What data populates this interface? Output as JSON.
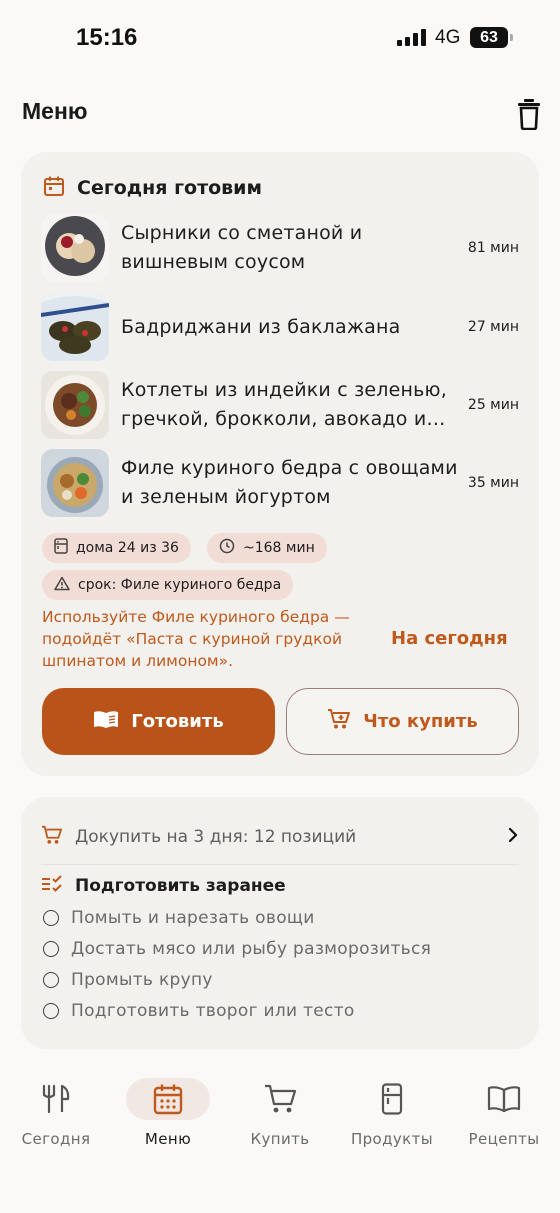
{
  "status": {
    "time": "15:16",
    "network": "4G",
    "battery": "63"
  },
  "header": {
    "title": "Меню",
    "trash_icon": "trash-icon"
  },
  "today": {
    "title": "Сегодня готовим",
    "dishes": [
      {
        "name": "Сырники со сметаной и вишневым соусом",
        "time": "81 мин"
      },
      {
        "name": "Бадриджани из баклажана",
        "time": "27 мин"
      },
      {
        "name": "Котлеты из индейки с зеленью, гречкой, брокколи, авокадо и…",
        "time": "25 мин"
      },
      {
        "name": "Филе куриного бедра с овощами и зеленым йогуртом",
        "time": "35 мин"
      }
    ],
    "chips": {
      "home": "дома 24 из 36",
      "duration": "~168 мин",
      "expiry": "срок: Филе куриного бедра"
    },
    "suggestion": "Используйте Филе куриного бедра — подойдёт «Паста с куриной грудкой шпинатом и лимоном».",
    "suggestion_action": "На сегодня",
    "cook_button": "Готовить",
    "buy_button": "Что купить"
  },
  "prep": {
    "restock": "Докупить на 3 дня: 12 позиций",
    "title": "Подготовить заранее",
    "tasks": [
      "Помыть и нарезать овощи",
      "Достать мясо или рыбу разморозиться",
      "Промыть крупу",
      "Подготовить творог или тесто"
    ]
  },
  "tabs": [
    {
      "label": "Сегодня",
      "icon": "fork-knife-icon",
      "active": false
    },
    {
      "label": "Меню",
      "icon": "calendar-icon",
      "active": true
    },
    {
      "label": "Купить",
      "icon": "cart-icon",
      "active": false
    },
    {
      "label": "Продукты",
      "icon": "fridge-icon",
      "active": false
    },
    {
      "label": "Рецепты",
      "icon": "book-icon",
      "active": false
    }
  ],
  "colors": {
    "accent": "#c0591c",
    "primary_button": "#b9531a",
    "card": "#f3f1ed",
    "chip": "#f2dcd6",
    "background": "#faf9f7"
  }
}
